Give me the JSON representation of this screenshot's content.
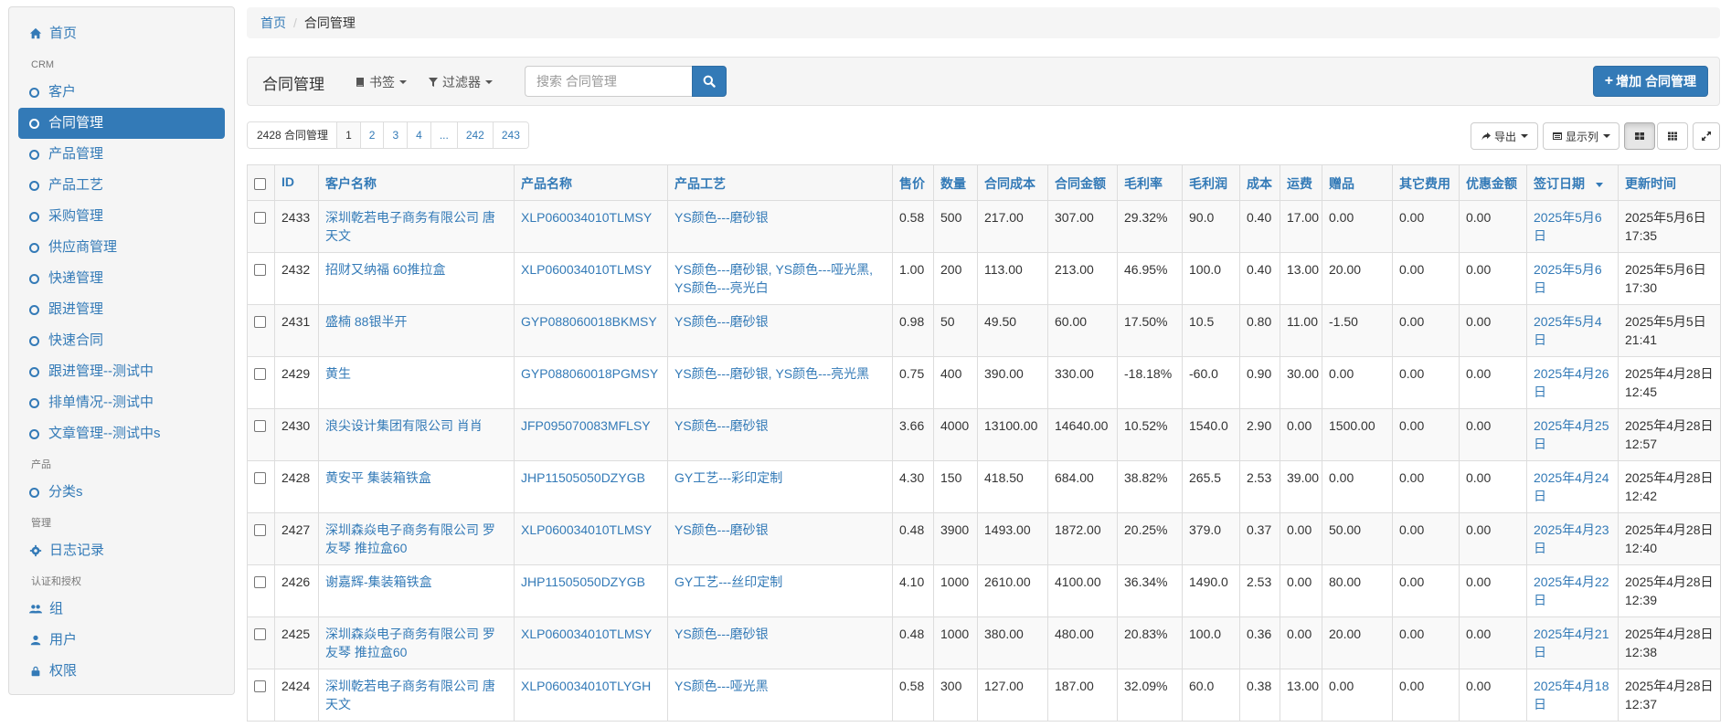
{
  "sidebar": {
    "home": "首页",
    "sections": [
      {
        "header": "CRM",
        "items": [
          "客户",
          "合同管理",
          "产品管理",
          "产品工艺",
          "采购管理",
          "供应商管理",
          "快递管理",
          "跟进管理",
          "快速合同",
          "跟进管理--测试中",
          "排单情况--测试中",
          "文章管理--测试中s"
        ]
      },
      {
        "header": "产品",
        "items": [
          "分类s"
        ]
      },
      {
        "header": "管理",
        "items": [
          "日志记录"
        ]
      },
      {
        "header": "认证和授权",
        "items": [
          "组",
          "用户",
          "权限"
        ]
      }
    ],
    "active": "合同管理"
  },
  "breadcrumb": {
    "home": "首页",
    "current": "合同管理"
  },
  "toolbar": {
    "title": "合同管理",
    "bookmarks": "书签",
    "filters": "过滤器",
    "search_placeholder": "搜索 合同管理",
    "add_label": "增加 合同管理"
  },
  "pagination": {
    "count": "2428",
    "count_label": "合同管理",
    "pages": [
      "1",
      "2",
      "3",
      "4",
      "...",
      "242",
      "243"
    ],
    "current": "1"
  },
  "actions": {
    "export": "导出",
    "columns": "显示列"
  },
  "table": {
    "columns": [
      "ID",
      "客户名称",
      "产品名称",
      "产品工艺",
      "售价",
      "数量",
      "合同成本",
      "合同金额",
      "毛利率",
      "毛利润",
      "成本",
      "运费",
      "赠品",
      "其它费用",
      "优惠金额",
      "签订日期",
      "更新时间"
    ],
    "rows": [
      [
        "2433",
        "深圳乾若电子商务有限公司 唐天文",
        "XLP060034010TLMSY",
        "YS颜色---磨砂银",
        "0.58",
        "500",
        "217.00",
        "307.00",
        "29.32%",
        "90.0",
        "0.40",
        "17.00",
        "0.00",
        "0.00",
        "0.00",
        "2025年5月6日",
        "2025年5月6日 17:35"
      ],
      [
        "2432",
        "招财又纳福 60推拉盒",
        "XLP060034010TLMSY",
        "YS颜色---磨砂银, YS颜色---哑光黑, YS颜色---亮光白",
        "1.00",
        "200",
        "113.00",
        "213.00",
        "46.95%",
        "100.0",
        "0.40",
        "13.00",
        "20.00",
        "0.00",
        "0.00",
        "2025年5月6日",
        "2025年5月6日 17:30"
      ],
      [
        "2431",
        "盛楠 88银半开",
        "GYP088060018BKMSY",
        "YS颜色---磨砂银",
        "0.98",
        "50",
        "49.50",
        "60.00",
        "17.50%",
        "10.5",
        "0.80",
        "11.00",
        "-1.50",
        "0.00",
        "0.00",
        "2025年5月4日",
        "2025年5月5日 21:41"
      ],
      [
        "2429",
        "黄生",
        "GYP088060018PGMSY",
        "YS颜色---磨砂银, YS颜色---亮光黑",
        "0.75",
        "400",
        "390.00",
        "330.00",
        "-18.18%",
        "-60.0",
        "0.90",
        "30.00",
        "0.00",
        "0.00",
        "0.00",
        "2025年4月26日",
        "2025年4月28日 12:45"
      ],
      [
        "2430",
        "浪尖设计集团有限公司 肖肖",
        "JFP095070083MFLSY",
        "YS颜色---磨砂银",
        "3.66",
        "4000",
        "13100.00",
        "14640.00",
        "10.52%",
        "1540.0",
        "2.90",
        "0.00",
        "1500.00",
        "0.00",
        "0.00",
        "2025年4月25日",
        "2025年4月28日 12:57"
      ],
      [
        "2428",
        "黄安平 集装箱铁盒",
        "JHP11505050DZYGB",
        "GY工艺---彩印定制",
        "4.30",
        "150",
        "418.50",
        "684.00",
        "38.82%",
        "265.5",
        "2.53",
        "39.00",
        "0.00",
        "0.00",
        "0.00",
        "2025年4月24日",
        "2025年4月28日 12:42"
      ],
      [
        "2427",
        "深圳森焱电子商务有限公司 罗友琴 推拉盒60",
        "XLP060034010TLMSY",
        "YS颜色---磨砂银",
        "0.48",
        "3900",
        "1493.00",
        "1872.00",
        "20.25%",
        "379.0",
        "0.37",
        "0.00",
        "50.00",
        "0.00",
        "0.00",
        "2025年4月23日",
        "2025年4月28日 12:40"
      ],
      [
        "2426",
        "谢嘉辉-集装箱铁盒",
        "JHP11505050DZYGB",
        "GY工艺---丝印定制",
        "4.10",
        "1000",
        "2610.00",
        "4100.00",
        "36.34%",
        "1490.0",
        "2.53",
        "0.00",
        "80.00",
        "0.00",
        "0.00",
        "2025年4月22日",
        "2025年4月28日 12:39"
      ],
      [
        "2425",
        "深圳森焱电子商务有限公司 罗友琴 推拉盒60",
        "XLP060034010TLMSY",
        "YS颜色---磨砂银",
        "0.48",
        "1000",
        "380.00",
        "480.00",
        "20.83%",
        "100.0",
        "0.36",
        "0.00",
        "20.00",
        "0.00",
        "0.00",
        "2025年4月21日",
        "2025年4月28日 12:38"
      ],
      [
        "2424",
        "深圳乾若电子商务有限公司 唐天文",
        "XLP060034010TLYGH",
        "YS颜色---哑光黑",
        "0.58",
        "300",
        "127.00",
        "187.00",
        "32.09%",
        "60.0",
        "0.38",
        "13.00",
        "0.00",
        "0.00",
        "0.00",
        "2025年4月18日",
        "2025年4月28日 12:37"
      ]
    ]
  },
  "colors": {
    "primary": "#337ab7",
    "panel": "#f5f5f5",
    "border": "#dddddd"
  }
}
